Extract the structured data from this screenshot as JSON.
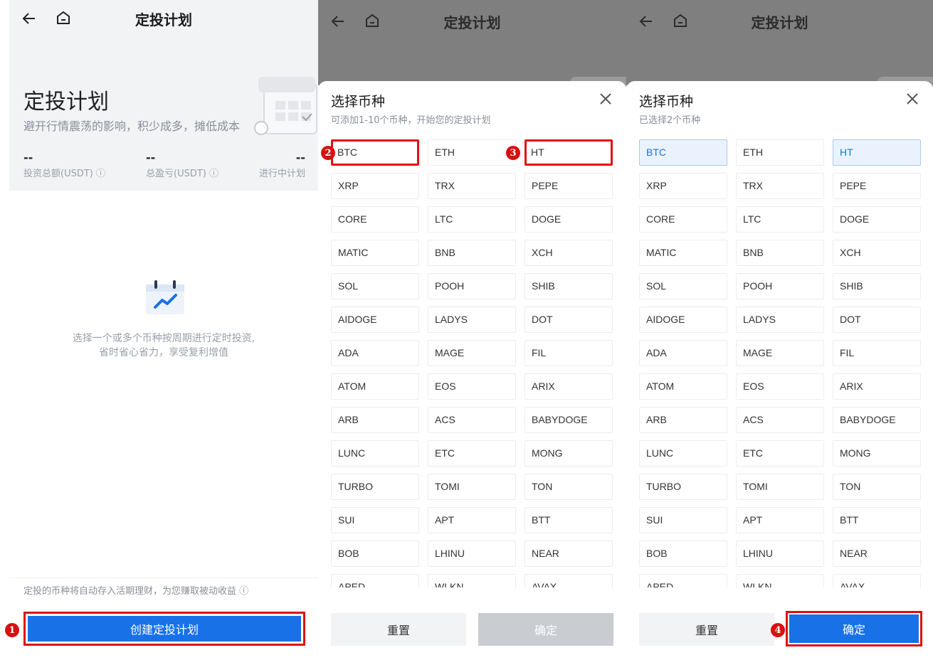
{
  "panel1": {
    "nav_title": "定投计划",
    "hero_title": "定投计划",
    "hero_subtitle": "避开行情震荡的影响，积少成多，摊低成本",
    "stats": [
      {
        "value": "--",
        "label": "投资总额(USDT)",
        "info": "ⓘ"
      },
      {
        "value": "--",
        "label": "总盈亏(USDT)",
        "info": "ⓘ"
      },
      {
        "value": "--",
        "label": "进行中计划",
        "info": ""
      }
    ],
    "empty_line1": "选择一个或多个币种按周期进行定时投资,",
    "empty_line2": "省时省心省力，享受复利增值",
    "note": "定投的币种将自动存入活期理财，为您赚取被动收益 ⓘ",
    "create_button": "创建定投计划",
    "step": "1"
  },
  "panel2": {
    "nav_title": "定投计划",
    "sheet_title": "选择币种",
    "sheet_subtitle": "可添加1-10个币种，开始您的定投计划",
    "reset_label": "重置",
    "confirm_label": "确定",
    "steps": [
      "2",
      "3"
    ]
  },
  "panel3": {
    "nav_title": "定投计划",
    "sheet_title": "选择币种",
    "sheet_subtitle": "已选择2个币种",
    "reset_label": "重置",
    "confirm_label": "确定",
    "step": "4"
  },
  "coins": [
    "BTC",
    "ETH",
    "HT",
    "XRP",
    "TRX",
    "PEPE",
    "CORE",
    "LTC",
    "DOGE",
    "MATIC",
    "BNB",
    "XCH",
    "SOL",
    "POOH",
    "SHIB",
    "AIDOGE",
    "LADYS",
    "DOT",
    "ADA",
    "MAGE",
    "FIL",
    "ATOM",
    "EOS",
    "ARIX",
    "ARB",
    "ACS",
    "BABYDOGE",
    "LUNC",
    "ETC",
    "MONG",
    "TURBO",
    "TOMI",
    "TON",
    "SUI",
    "APT",
    "BTT",
    "BOB",
    "LHINU",
    "NEAR",
    "APED",
    "WLKN",
    "AVAX"
  ],
  "selected_coins": [
    "BTC",
    "HT"
  ],
  "colors": {
    "accent": "#1971e8",
    "highlight": "#e01010",
    "selected_bg": "#eaf3fd"
  }
}
